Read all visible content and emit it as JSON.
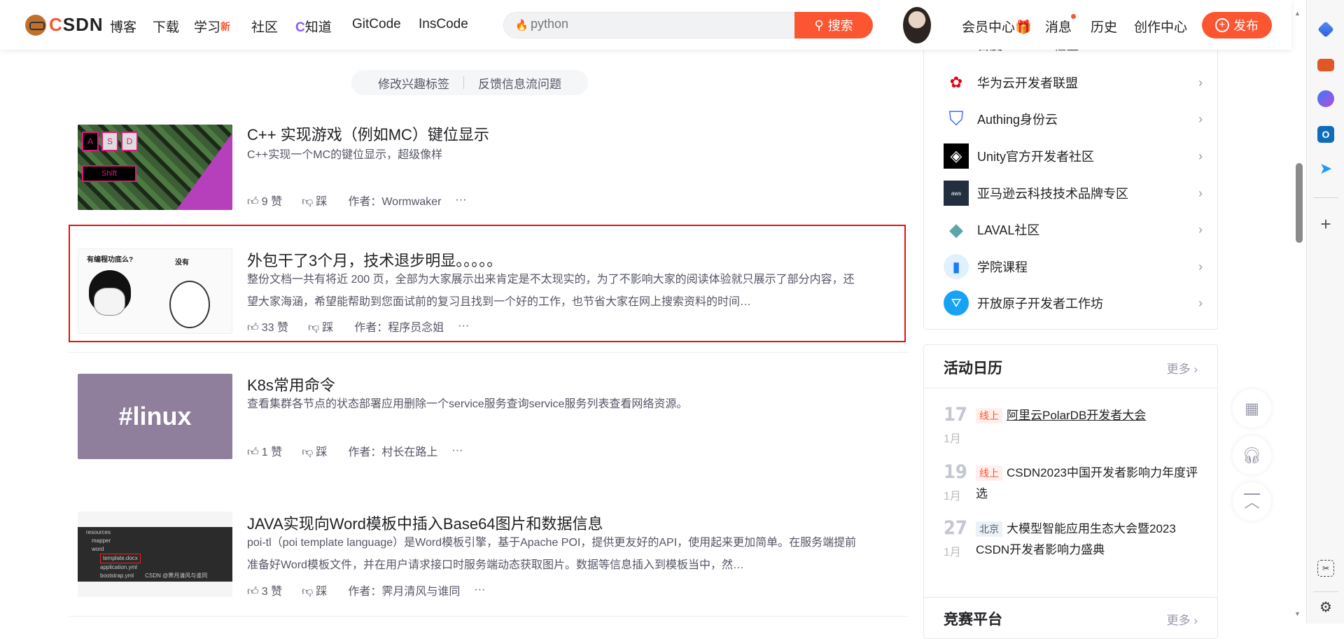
{
  "header": {
    "logo": "CSDN",
    "nav": [
      "博客",
      "下载",
      "学习",
      "社区",
      "知道",
      "GitCode",
      "InsCode"
    ],
    "learn_badge": "新",
    "search_value": "python",
    "search_button": "搜索",
    "member": "会员中心",
    "messages": "消息",
    "history": "历史",
    "creation": "创作中心",
    "publish": "发布",
    "brand_color": "#fc5531"
  },
  "filter": {
    "edit_tags": "修改兴趣标签",
    "feedback": "反馈信息流问题"
  },
  "articles": [
    {
      "title": "C++ 实现游戏（例如MC）键位显示",
      "desc": "C++实现一个MC的键位显示，超级像样",
      "likes": "9 赞",
      "dislike": "踩",
      "author": "作者：Wormwaker",
      "more": "···",
      "thumb_keys": [
        "A",
        "S",
        "D",
        "Shift"
      ]
    },
    {
      "title": "外包干了3个月，技术退步明显。。。。。",
      "desc": "整份文档一共有将近 200 页，全部为大家展示出来肯定是不太现实的，为了不影响大家的阅读体验就只展示了部分内容，还望大家海涵，希望能帮助到您面试前的复习且找到一个好的工作，也节省大家在网上搜索资料的时间…",
      "likes": "33 赞",
      "dislike": "踩",
      "author": "作者：程序员念姐",
      "more": "···",
      "thumb_text": [
        "有编程功底么?",
        "没有"
      ]
    },
    {
      "title": "K8s常用命令",
      "desc": "查看集群各节点的状态部署应用删除一个service服务查询service服务列表查看网络资源。",
      "likes": "1 赞",
      "dislike": "踩",
      "author": "作者：村长在路上",
      "more": "···",
      "thumb_text": "#linux"
    },
    {
      "title": "JAVA实现向Word模板中插入Base64图片和数据信息",
      "desc": "poi-tl（poi template language）是Word模板引擎，基于Apache POI，提供更友好的API，使用起来更加简单。在服务端提前准备好Word模板文件，并在用户请求接口时服务端动态获取图片。数据等信息插入到模板当中，然…",
      "likes": "3 赞",
      "dislike": "踩",
      "author": "作者：霁月清风与谁同",
      "more": "···",
      "thumb_files": [
        "resources",
        "mapper",
        "word",
        "template.docx",
        "application.yml",
        "bootstrap.yml",
        "CSDN @霁月清风与谁同"
      ]
    }
  ],
  "sidebar": {
    "communities": [
      "百度AI Studio社区",
      "华为云开发者联盟",
      "Authing身份云",
      "Unity官方开发者社区",
      "亚马逊云科技技术品牌专区",
      "LAVAL社区",
      "学院课程",
      "开放原子开发者工作坊"
    ],
    "calendar": {
      "title": "活动日历",
      "more": "更多",
      "events": [
        {
          "day": "17",
          "month": "1月",
          "tag": "线上",
          "text": "阿里云PolarDB开发者大会"
        },
        {
          "day": "19",
          "month": "1月",
          "tag": "线上",
          "text": "CSDN2023中国开发者影响力年度评选"
        },
        {
          "day": "27",
          "month": "1月",
          "tag": "北京",
          "text": "大模型智能应用生态大会暨2023 CSDN开发者影响力盛典"
        }
      ]
    },
    "contest": {
      "title": "竞赛平台",
      "more": "更多"
    }
  }
}
